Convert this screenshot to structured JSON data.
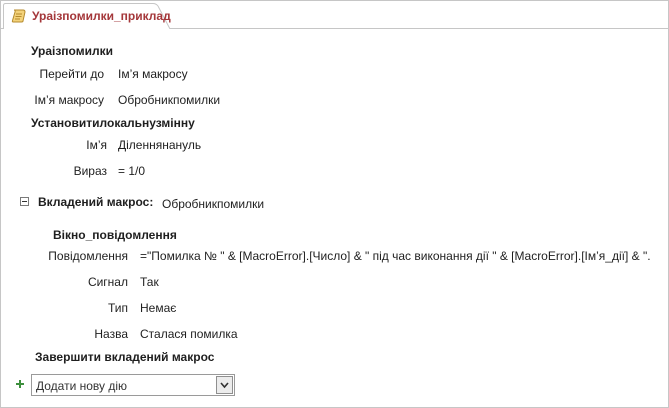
{
  "tab": {
    "title": "Ураізпомилки_приклад",
    "icon": "macro-scroll-icon"
  },
  "macro": {
    "header": "Ураізпомилки",
    "goto": {
      "label": "Перейти до",
      "value": "Ім’я макросу"
    },
    "macro_name": {
      "label": "Ім’я макросу",
      "value": "Обробникпомилки"
    },
    "setlocalvar": {
      "header": "Установитилокальнузмінну",
      "name": {
        "label": "Ім’я",
        "value": "Діленнянануль"
      },
      "expr": {
        "label": "Вираз",
        "value": "= 1/0"
      }
    },
    "submacro": {
      "label": "Вкладений макрос:",
      "name": "Обробникпомилки",
      "msgbox": {
        "header": "Вікно_повідомлення",
        "message": {
          "label": "Повідомлення",
          "value": "=\"Помилка № \" & [MacroError].[Число] & \" під час виконання дії \" & [MacroError].[Ім’я_дії] & \"."
        },
        "beep": {
          "label": "Сигнал",
          "value": "Так"
        },
        "type": {
          "label": "Тип",
          "value": "Немає"
        },
        "title": {
          "label": "Назва",
          "value": "Сталася помилка"
        }
      },
      "end_label": "Завершити вкладений макрос"
    },
    "add_action": {
      "placeholder": "Додати нову дію"
    }
  },
  "colors": {
    "tab_title": "#a4373a",
    "border": "#c6c6c6",
    "plus": "#3d8f3d"
  }
}
